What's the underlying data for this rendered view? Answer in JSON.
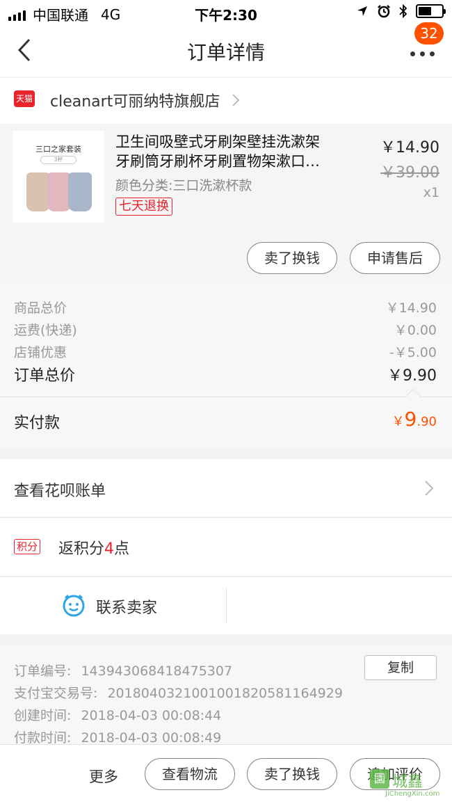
{
  "status_bar": {
    "carrier": "中国联通",
    "network": "4G",
    "time": "下午2:30"
  },
  "nav": {
    "title": "订单详情",
    "badge": "32"
  },
  "store": {
    "platform": "天猫",
    "name": "cleanart可丽纳特旗舰店"
  },
  "product": {
    "thumb_title": "三口之家套装",
    "thumb_sub": "3杯",
    "name_line1": "卫生间吸壁式牙刷架壁挂洗漱架",
    "name_line2": "牙刷筒牙刷杯牙刷置物架漱口…",
    "sku": "颜色分类:三口洗漱杯款",
    "tag": "七天退换",
    "price": "￥14.90",
    "original_price": "￥39.00",
    "quantity": "x1",
    "btn_sell": "卖了换钱",
    "btn_aftersale": "申请售后"
  },
  "summary": {
    "rows": [
      {
        "label": "商品总价",
        "value": "￥14.90"
      },
      {
        "label": "运费(快递)",
        "value": "￥0.00"
      },
      {
        "label": "店铺优惠",
        "value": "-￥5.00"
      }
    ],
    "total_label": "订单总价",
    "total_value": "￥9.90",
    "paid_label": "实付款",
    "paid_currency": "￥",
    "paid_integer": "9",
    "paid_decimal": ".90"
  },
  "huabei": {
    "label": "查看花呗账单"
  },
  "points": {
    "tag": "积分",
    "text_prefix": "返积分",
    "number": "4",
    "text_suffix": "点"
  },
  "contact": {
    "label": "联系卖家"
  },
  "order_info": {
    "order_no_label": "订单编号:",
    "order_no": "143943068418475307",
    "copy_label": "复制",
    "alipay_label": "支付宝交易号:",
    "alipay_no": "2018040321001001820581164929",
    "created_label": "创建时间:",
    "created_time": "2018-04-03 00:08:44",
    "paid_label": "付款时间:",
    "paid_time": "2018-04-03 00:08:49"
  },
  "bottom_bar": {
    "more": "更多",
    "logistics": "查看物流",
    "sell": "卖了换钱",
    "review": "追加评价"
  },
  "watermark": {
    "name": "城鑫",
    "url": "JiChengXin.com"
  },
  "colors": {
    "accent": "#ff5000",
    "tmall_red": "#e8232c"
  }
}
